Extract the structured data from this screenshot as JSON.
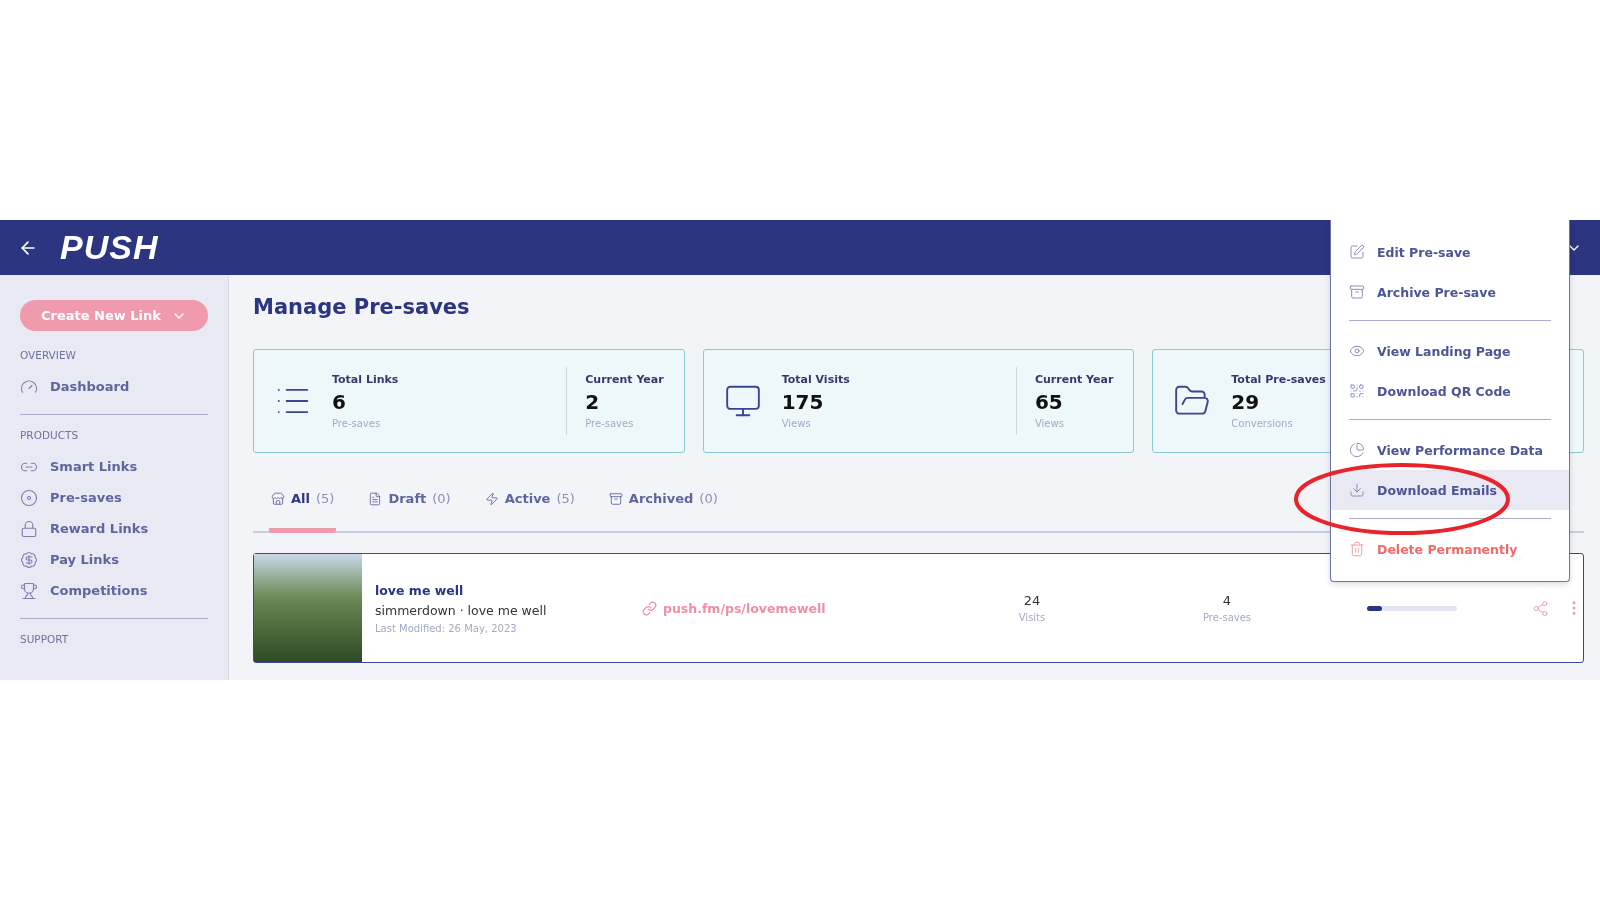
{
  "header": {
    "logo": "PUSH"
  },
  "sidebar": {
    "create_button": "Create New Link",
    "sections": [
      {
        "title": "OVERVIEW",
        "items": [
          {
            "label": "Dashboard"
          }
        ]
      },
      {
        "title": "PRODUCTS",
        "items": [
          {
            "label": "Smart Links"
          },
          {
            "label": "Pre-saves"
          },
          {
            "label": "Reward Links"
          },
          {
            "label": "Pay Links"
          },
          {
            "label": "Competitions"
          }
        ]
      },
      {
        "title": "SUPPORT"
      }
    ]
  },
  "page_title": "Manage Pre-saves",
  "stat_cards": [
    {
      "stats": [
        {
          "label": "Total Links",
          "value": "6",
          "unit": "Pre-saves"
        },
        {
          "label": "Current Year",
          "value": "2",
          "unit": "Pre-saves"
        }
      ]
    },
    {
      "stats": [
        {
          "label": "Total Visits",
          "value": "175",
          "unit": "Views"
        },
        {
          "label": "Current Year",
          "value": "65",
          "unit": "Views"
        }
      ]
    },
    {
      "stats": [
        {
          "label": "Total Pre-saves",
          "value": "29",
          "unit": "Conversions"
        }
      ]
    }
  ],
  "tabs": [
    {
      "label": "All",
      "count": "(5)",
      "selected": true
    },
    {
      "label": "Draft",
      "count": "(0)",
      "selected": false
    },
    {
      "label": "Active",
      "count": "(5)",
      "selected": false
    },
    {
      "label": "Archived",
      "count": "(0)",
      "selected": false
    }
  ],
  "links": [
    {
      "title": "love me well",
      "subtitle": "simmerdown · love me well",
      "modified": "Last Modified: 26 May, 2023",
      "url": "push.fm/ps/lovemewell",
      "visits": "24",
      "visits_label": "Visits",
      "presaves": "4",
      "presaves_label": "Pre-saves",
      "level": 0.17
    }
  ],
  "menu": {
    "groups": [
      [
        {
          "label": "Edit Pre-save",
          "kind": "normal",
          "highlighted": false
        },
        {
          "label": "Archive Pre-save",
          "kind": "normal",
          "highlighted": false
        }
      ],
      [
        {
          "label": "View Landing Page",
          "kind": "normal",
          "highlighted": false
        },
        {
          "label": "Download QR Code",
          "kind": "normal",
          "highlighted": false
        }
      ],
      [
        {
          "label": "View Performance Data",
          "kind": "normal",
          "highlighted": false
        },
        {
          "label": "Download Emails",
          "kind": "normal",
          "highlighted": true
        }
      ],
      [
        {
          "label": "Delete Permanently",
          "kind": "danger",
          "highlighted": false
        }
      ]
    ]
  }
}
